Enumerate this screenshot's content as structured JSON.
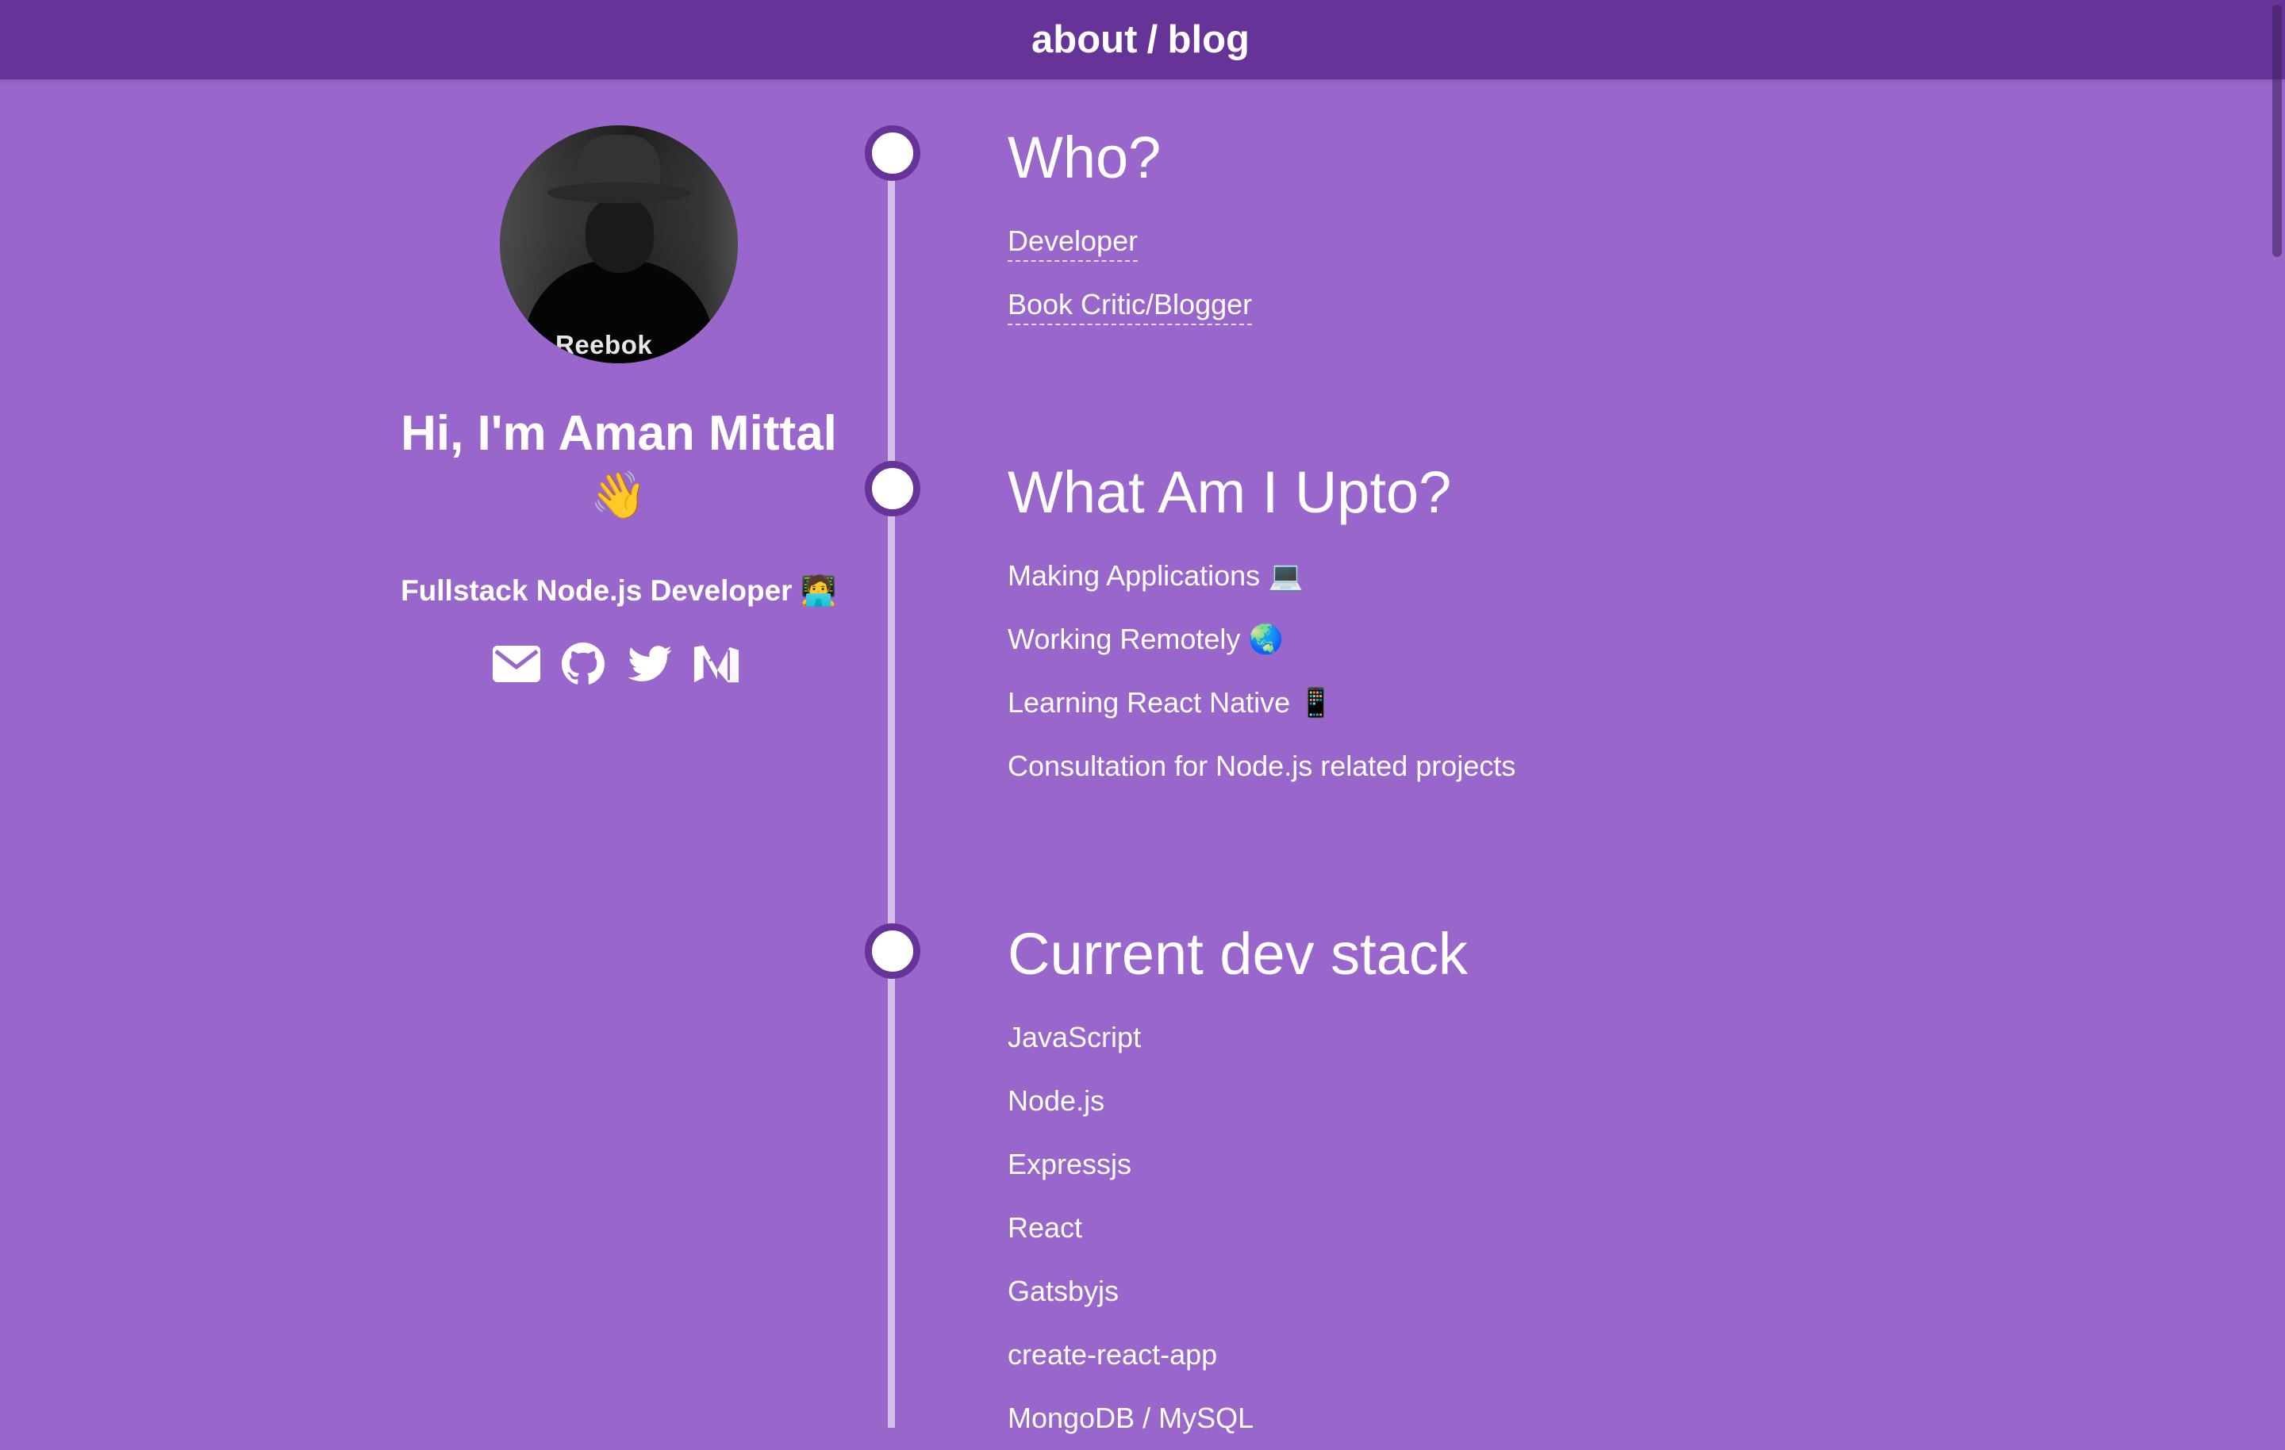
{
  "nav": {
    "about_label": "about",
    "separator": "/",
    "blog_label": "blog"
  },
  "profile": {
    "greeting": "Hi, I'm Aman Mittal",
    "wave": "👋",
    "tagline": "Fullstack Node.js Developer 🧑‍💻",
    "avatar_brand": "Reebok",
    "socials": [
      {
        "icon": "envelope-icon"
      },
      {
        "icon": "github-icon"
      },
      {
        "icon": "twitter-icon"
      },
      {
        "icon": "medium-icon"
      }
    ]
  },
  "sections": {
    "who": {
      "title": "Who?",
      "items": [
        "Developer",
        "Book Critic/Blogger"
      ]
    },
    "upto": {
      "title": "What Am I Upto?",
      "items": [
        "Making Applications 💻",
        "Working Remotely 🌏",
        "Learning React Native 📱",
        "Consultation for Node.js related projects"
      ]
    },
    "stack": {
      "title": "Current dev stack",
      "items": [
        "JavaScript",
        "Node.js",
        "Expressjs",
        "React",
        "Gatsbyjs",
        "create-react-app",
        "MongoDB / MySQL"
      ]
    }
  },
  "colors": {
    "background": "#9966cc",
    "header": "#663399",
    "timeline": "#d4bfe8",
    "text": "#ffffff"
  }
}
